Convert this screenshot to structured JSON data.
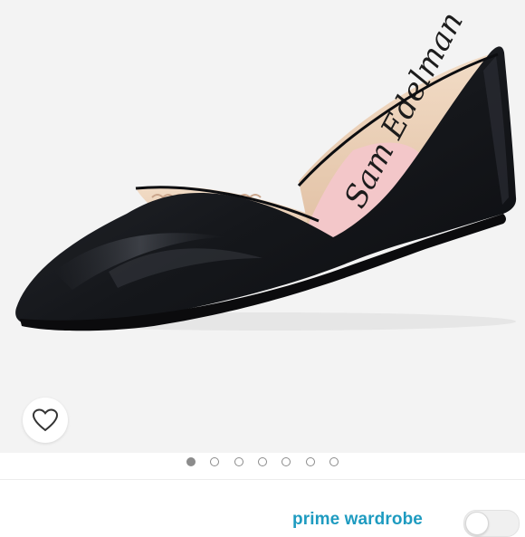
{
  "product": {
    "image_icon": "black-pointed-toe-flat-image",
    "insole_logo": "Sam Edelman"
  },
  "favorite": {
    "icon": "heart-outline-icon"
  },
  "carousel": {
    "total_images": 7,
    "active_index": 0
  },
  "footer": {
    "prime_label": "prime wardrobe",
    "toggle_on": false
  },
  "colors": {
    "image_background": "#f3f3f3",
    "accent": "#1e9bc0",
    "dot": "#8c8c8c"
  }
}
